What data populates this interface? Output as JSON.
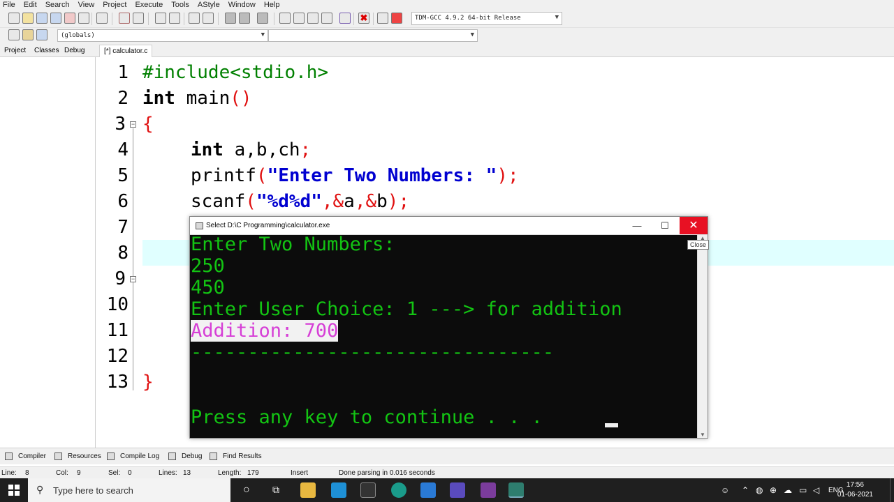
{
  "menu": [
    "File",
    "Edit",
    "Search",
    "View",
    "Project",
    "Execute",
    "Tools",
    "AStyle",
    "Window",
    "Help"
  ],
  "toolbar": {
    "compiler_select": "TDM-GCC 4.9.2 64-bit Release",
    "scope_select": "(globals)",
    "symbol_select": ""
  },
  "left_tabs": [
    "Project",
    "Classes",
    "Debug"
  ],
  "editor": {
    "file_tab": "[*] calculator.c",
    "line_numbers": [
      "1",
      "2",
      "3",
      "4",
      "5",
      "6",
      "7",
      "8",
      "9",
      "10",
      "11",
      "12",
      "13"
    ],
    "lines": {
      "l1": "#include<stdio.h>",
      "l2_kw": "int",
      "l2_rest": " main",
      "l2_paren": "()",
      "l3": "{",
      "l4_kw": "int",
      "l4_rest": " a,b,ch",
      "l4_semi": ";",
      "l5_fn": "printf",
      "l5_open": "(",
      "l5_str": "\"Enter Two Numbers: \"",
      "l5_close": ");",
      "l6_fn": "scanf",
      "l6_open": "(",
      "l6_str": "\"%d%d\"",
      "l6_c1": ",&",
      "l6_a": "a",
      "l6_c2": ",&",
      "l6_b": "b",
      "l6_close": ");",
      "l13": "}"
    }
  },
  "console": {
    "title": "Select D:\\C Programming\\calculator.exe",
    "min_glyph": "—",
    "max_glyph": "☐",
    "close_glyph": "✕",
    "tooltip": "Close",
    "output": [
      "Enter Two Numbers:",
      "250",
      "450",
      "Enter User Choice: 1 ---> for addition",
      "Addition: 700",
      "--------------------------------",
      "",
      "",
      "Press any key to continue . . ."
    ]
  },
  "bottom_tabs": [
    "Compiler",
    "Resources",
    "Compile Log",
    "Debug",
    "Find Results"
  ],
  "status": {
    "line_label": "Line:",
    "line": "8",
    "col_label": "Col:",
    "col": "9",
    "sel_label": "Sel:",
    "sel": "0",
    "lines_label": "Lines:",
    "lines": "13",
    "length_label": "Length:",
    "length": "179",
    "mode": "Insert",
    "message": "Done parsing in 0.016 seconds"
  },
  "taskbar": {
    "search_placeholder": "Type here to search",
    "lang": "ENG",
    "time": "17:56",
    "date": "01-06-2021"
  },
  "colors": {
    "console_text": "#13c413",
    "console_highlight": "#d63fd6",
    "current_line": "#e0ffff",
    "close_red": "#e81123"
  }
}
